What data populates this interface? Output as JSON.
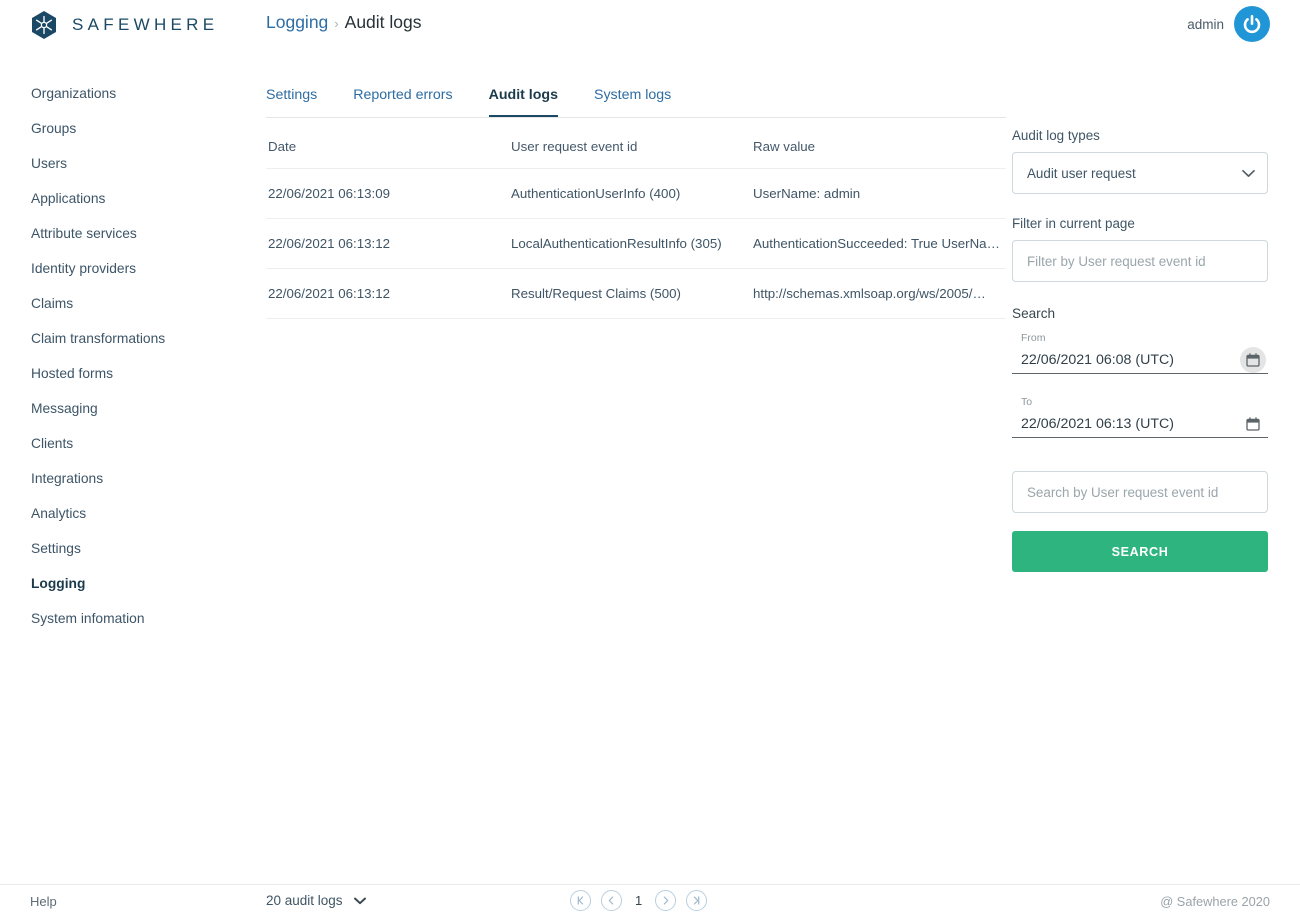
{
  "brand": {
    "name": "SAFEWHERE",
    "logo_icon": "safewhere-hex-snowflake-logo"
  },
  "breadcrumb": {
    "parent": "Logging",
    "separator": "›",
    "current": "Audit logs"
  },
  "user": {
    "name": "admin",
    "power_icon": "power-logout-icon"
  },
  "sidebar": {
    "items": [
      {
        "label": "Organizations",
        "active": false
      },
      {
        "label": "Groups",
        "active": false
      },
      {
        "label": "Users",
        "active": false
      },
      {
        "label": "Applications",
        "active": false
      },
      {
        "label": "Attribute services",
        "active": false
      },
      {
        "label": "Identity providers",
        "active": false
      },
      {
        "label": "Claims",
        "active": false
      },
      {
        "label": "Claim transformations",
        "active": false
      },
      {
        "label": "Hosted forms",
        "active": false
      },
      {
        "label": "Messaging",
        "active": false
      },
      {
        "label": "Clients",
        "active": false
      },
      {
        "label": "Integrations",
        "active": false
      },
      {
        "label": "Analytics",
        "active": false
      },
      {
        "label": "Settings",
        "active": false
      },
      {
        "label": "Logging",
        "active": true
      },
      {
        "label": "System infomation",
        "active": false
      }
    ]
  },
  "tabs": [
    {
      "label": "Settings",
      "active": false
    },
    {
      "label": "Reported errors",
      "active": false
    },
    {
      "label": "Audit logs",
      "active": true
    },
    {
      "label": "System logs",
      "active": false
    }
  ],
  "table": {
    "columns": [
      "Date",
      "User request event id",
      "Raw value"
    ],
    "rows": [
      {
        "date": "22/06/2021 06:13:09",
        "event_id": "AuthenticationUserInfo (400)",
        "raw_value": "UserName: admin"
      },
      {
        "date": "22/06/2021 06:13:12",
        "event_id": "LocalAuthenticationResultInfo (305)",
        "raw_value": "AuthenticationSucceeded: True UserNa…"
      },
      {
        "date": "22/06/2021 06:13:12",
        "event_id": "Result/Request Claims (500)",
        "raw_value": "http://schemas.xmlsoap.org/ws/2005/…"
      }
    ]
  },
  "right_panel": {
    "log_types_label": "Audit log types",
    "log_types_selected": "Audit user request",
    "filter_label": "Filter in current page",
    "filter_placeholder": "Filter by User request event id",
    "filter_value": "",
    "search_title": "Search",
    "from_label": "From",
    "from_value": "22/06/2021 06:08 (UTC)",
    "to_label": "To",
    "to_value": "22/06/2021 06:13 (UTC)",
    "search_placeholder": "Search by User request event id",
    "search_value": "",
    "search_button": "SEARCH",
    "calendar_icon": "calendar-icon",
    "caret_icon": "chevron-down-icon"
  },
  "footer": {
    "help": "Help",
    "page_size": "20 audit logs",
    "pager": {
      "first": "«K",
      "prev": "‹",
      "page": "1",
      "next": "›",
      "last": "»"
    },
    "copyright": "@ Safewhere 2020"
  },
  "colors": {
    "brand_blue": "#1b4965",
    "link_blue": "#2e6da4",
    "accent_green": "#2eb57f",
    "power_blue": "#2196d6"
  }
}
